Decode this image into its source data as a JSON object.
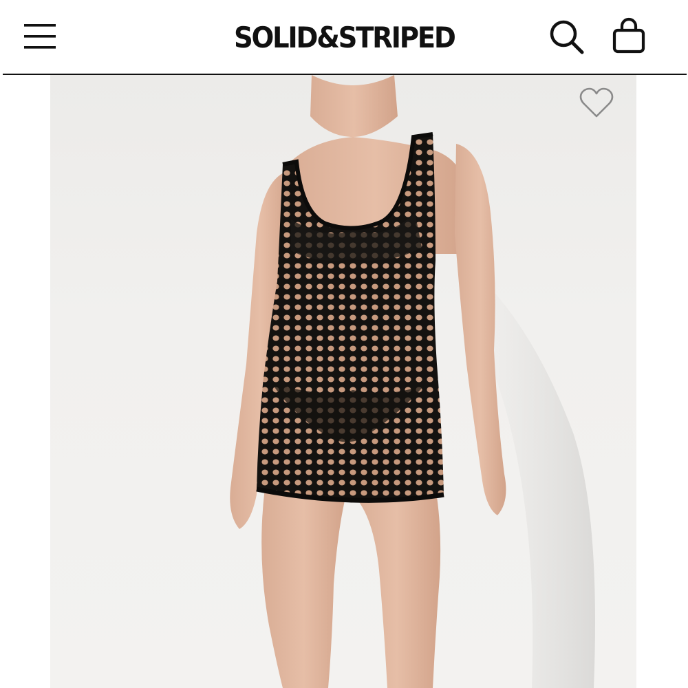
{
  "header": {
    "brand_logo_text": "SOLID&STRIPED",
    "menu_icon": "hamburger-menu-icon",
    "search_icon": "search-icon",
    "bag_icon": "shopping-bag-icon"
  },
  "product": {
    "image_description_icon": "product-photo",
    "wishlist_icon": "heart-outline-icon"
  },
  "colors": {
    "text": "#111111",
    "background": "#ffffff",
    "photo_background": "#efeeec",
    "wishlist_outline": "#8a8a8a"
  }
}
